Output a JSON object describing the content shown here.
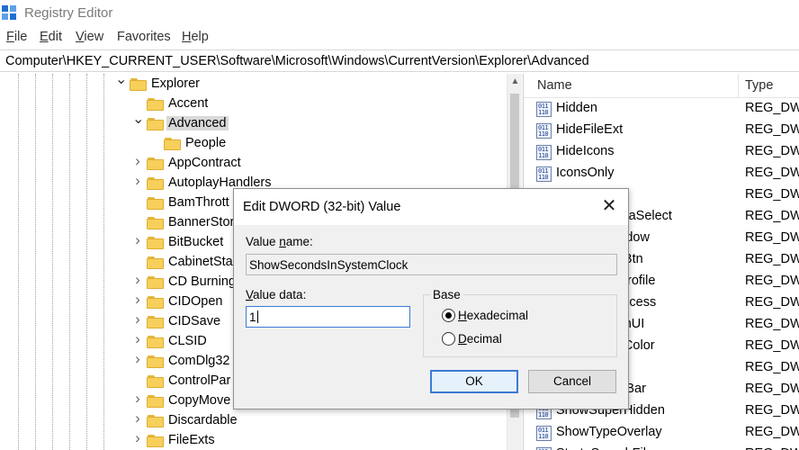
{
  "window": {
    "title": "Registry Editor",
    "accent_color": "#1f6fd1"
  },
  "menu": [
    {
      "label": "File",
      "mnemonic": "F",
      "rest": "ile"
    },
    {
      "label": "Edit",
      "mnemonic": "E",
      "rest": "dit"
    },
    {
      "label": "View",
      "mnemonic": "V",
      "rest": "iew"
    },
    {
      "label": "Favorites",
      "mnemonic": "",
      "rest": "Favorites"
    },
    {
      "label": "Help",
      "mnemonic": "H",
      "rest": "elp"
    }
  ],
  "address": {
    "path": "Computer\\HKEY_CURRENT_USER\\Software\\Microsoft\\Windows\\CurrentVersion\\Explorer\\Advanced"
  },
  "tree": {
    "items": [
      {
        "label": "Explorer",
        "expander": "expanded",
        "level": 0
      },
      {
        "label": "Accent",
        "expander": "none",
        "level": 1
      },
      {
        "label": "Advanced",
        "expander": "expanded",
        "level": 1,
        "selected": true
      },
      {
        "label": "People",
        "expander": "none",
        "level": 2
      },
      {
        "label": "AppContract",
        "expander": "collapsed",
        "level": 1
      },
      {
        "label": "AutoplayHandlers",
        "expander": "collapsed",
        "level": 1
      },
      {
        "label": "BamThrott",
        "expander": "none",
        "level": 1
      },
      {
        "label": "BannerStor",
        "expander": "none",
        "level": 1
      },
      {
        "label": "BitBucket",
        "expander": "collapsed",
        "level": 1
      },
      {
        "label": "CabinetSta",
        "expander": "none",
        "level": 1
      },
      {
        "label": "CD Burning",
        "expander": "collapsed",
        "level": 1
      },
      {
        "label": "CIDOpen",
        "expander": "collapsed",
        "level": 1
      },
      {
        "label": "CIDSave",
        "expander": "collapsed",
        "level": 1
      },
      {
        "label": "CLSID",
        "expander": "collapsed",
        "level": 1
      },
      {
        "label": "ComDlg32",
        "expander": "collapsed",
        "level": 1
      },
      {
        "label": "ControlPar",
        "expander": "none",
        "level": 1
      },
      {
        "label": "CopyMove",
        "expander": "collapsed",
        "level": 1
      },
      {
        "label": "Discardable",
        "expander": "collapsed",
        "level": 1
      },
      {
        "label": "FileExts",
        "expander": "collapsed",
        "level": 1
      }
    ]
  },
  "list": {
    "columns": {
      "name": "Name",
      "type": "Type"
    },
    "rows": [
      {
        "name": "Hidden",
        "type": "REG_DWORD"
      },
      {
        "name": "HideFileExt",
        "type": "REG_DWORD"
      },
      {
        "name": "HideIcons",
        "type": "REG_DWORD"
      },
      {
        "name": "IconsOnly",
        "type": "REG_DWORD"
      },
      {
        "name": "",
        "type": "REG_DWORD"
      },
      {
        "name": "ListviewAlphaSelect",
        "type": "REG_DWORD"
      },
      {
        "name": "ListviewShadow",
        "type": "REG_DWORD"
      },
      {
        "name": "MMTaskbarBtn",
        "type": "REG_DWORD"
      },
      {
        "name": "ReindexedProfile",
        "type": "REG_DWORD"
      },
      {
        "name": "SeparateProcess",
        "type": "REG_DWORD"
      },
      {
        "name": "ServerAdminUI",
        "type": "REG_DWORD"
      },
      {
        "name": "ShowCompColor",
        "type": "REG_DWORD"
      },
      {
        "name": "",
        "type": "REG_DWORD"
      },
      {
        "name": "ShowStatusBar",
        "type": "REG_DWORD"
      },
      {
        "name": "ShowSuperHidden",
        "type": "REG_DWORD"
      },
      {
        "name": "ShowTypeOverlay",
        "type": "REG_DWORD"
      },
      {
        "name": "Start_SearchFiles",
        "type": "REG_DWORD"
      }
    ]
  },
  "dialog": {
    "title": "Edit DWORD (32-bit) Value",
    "close_glyph": "✕",
    "value_name_label": "Value name:",
    "value_name": "ShowSecondsInSystemClock",
    "value_data_label": "Value data:",
    "value_data": "1",
    "base_label": "Base",
    "base_options": [
      {
        "label": "Hexadecimal",
        "checked": true
      },
      {
        "label": "Decimal",
        "checked": false
      }
    ],
    "ok_label": "OK",
    "cancel_label": "Cancel"
  }
}
